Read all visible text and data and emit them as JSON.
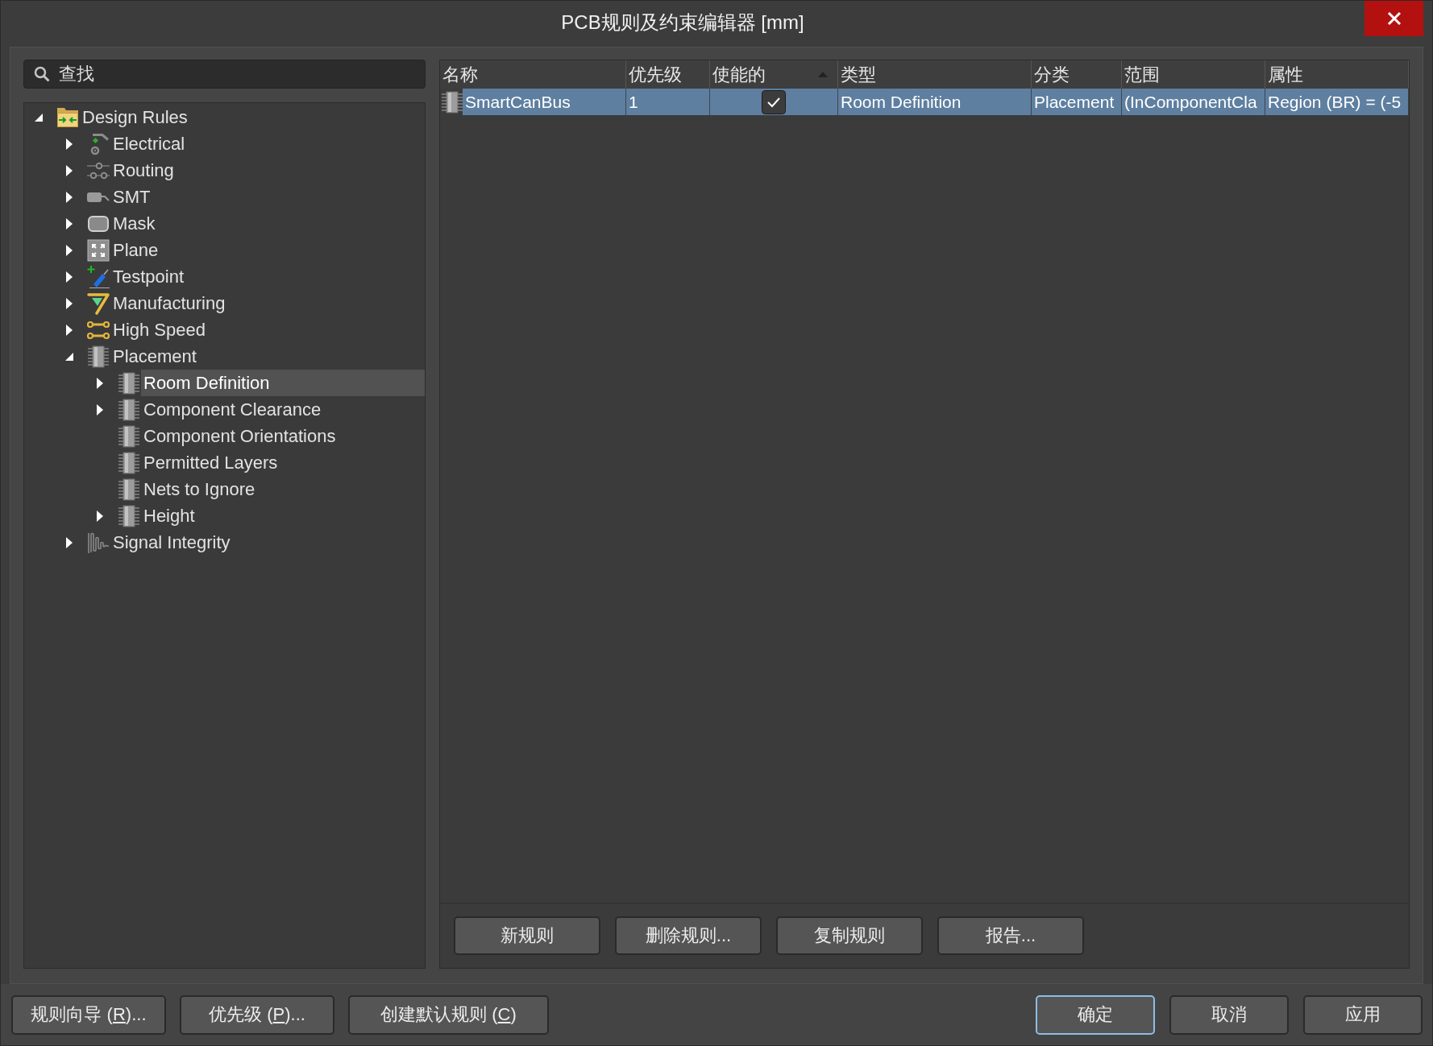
{
  "window": {
    "title": "PCB规则及约束编辑器 [mm]"
  },
  "search": {
    "placeholder": "查找"
  },
  "tree": [
    {
      "label": "Design Rules",
      "kind": "folder",
      "has_children": true,
      "expanded": true,
      "selected": false,
      "children": [
        {
          "label": "Electrical",
          "kind": "electrical",
          "has_children": true,
          "expanded": false,
          "selected": false
        },
        {
          "label": "Routing",
          "kind": "routing",
          "has_children": true,
          "expanded": false,
          "selected": false
        },
        {
          "label": "SMT",
          "kind": "smt",
          "has_children": true,
          "expanded": false,
          "selected": false
        },
        {
          "label": "Mask",
          "kind": "mask",
          "has_children": true,
          "expanded": false,
          "selected": false
        },
        {
          "label": "Plane",
          "kind": "plane",
          "has_children": true,
          "expanded": false,
          "selected": false
        },
        {
          "label": "Testpoint",
          "kind": "testpoint",
          "has_children": true,
          "expanded": false,
          "selected": false
        },
        {
          "label": "Manufacturing",
          "kind": "manufacturing",
          "has_children": true,
          "expanded": false,
          "selected": false
        },
        {
          "label": "High Speed",
          "kind": "highspeed",
          "has_children": true,
          "expanded": false,
          "selected": false
        },
        {
          "label": "Placement",
          "kind": "placement",
          "has_children": true,
          "expanded": true,
          "selected": false,
          "children": [
            {
              "label": "Room Definition",
              "kind": "placement",
              "has_children": true,
              "expanded": false,
              "selected": true
            },
            {
              "label": "Component Clearance",
              "kind": "placement",
              "has_children": true,
              "expanded": false,
              "selected": false
            },
            {
              "label": "Component Orientations",
              "kind": "placement",
              "has_children": false,
              "selected": false
            },
            {
              "label": "Permitted Layers",
              "kind": "placement",
              "has_children": false,
              "selected": false
            },
            {
              "label": "Nets to Ignore",
              "kind": "placement",
              "has_children": false,
              "selected": false
            },
            {
              "label": "Height",
              "kind": "placement",
              "has_children": true,
              "expanded": false,
              "selected": false
            }
          ]
        },
        {
          "label": "Signal Integrity",
          "kind": "signal",
          "has_children": true,
          "expanded": false,
          "selected": false
        }
      ]
    }
  ],
  "rules_table": {
    "columns": [
      {
        "label": "名称",
        "sorted": false
      },
      {
        "label": "优先级",
        "sorted": false
      },
      {
        "label": "使能的",
        "sorted": true
      },
      {
        "label": "类型",
        "sorted": false
      },
      {
        "label": "分类",
        "sorted": false
      },
      {
        "label": "范围",
        "sorted": false
      },
      {
        "label": "属性",
        "sorted": false
      }
    ],
    "rows": [
      {
        "selected": true,
        "cells": [
          {
            "kind": "name",
            "text": "SmartCanBus"
          },
          {
            "kind": "text",
            "text": "1"
          },
          {
            "kind": "checkbox",
            "checked": true
          },
          {
            "kind": "text",
            "text": "Room Definition"
          },
          {
            "kind": "text",
            "text": "Placement"
          },
          {
            "kind": "text",
            "text": "(InComponentCla"
          },
          {
            "kind": "text",
            "text": "Region (BR) = (-5"
          }
        ]
      }
    ]
  },
  "panel_buttons": [
    "新规则",
    "删除规则...",
    "复制规则",
    "报告..."
  ],
  "footer": {
    "left_buttons": [
      {
        "label": "规则向导 (",
        "access_key": "R",
        "label_end": ")..."
      },
      {
        "label": "优先级 (",
        "access_key": "P",
        "label_end": ")..."
      },
      {
        "label": "创建默认规则 (",
        "access_key": "C",
        "label_end": ")"
      }
    ],
    "right_buttons": [
      {
        "label": "确定",
        "default": true
      },
      {
        "label": "取消",
        "default": false
      },
      {
        "label": "应用",
        "default": false
      }
    ]
  }
}
